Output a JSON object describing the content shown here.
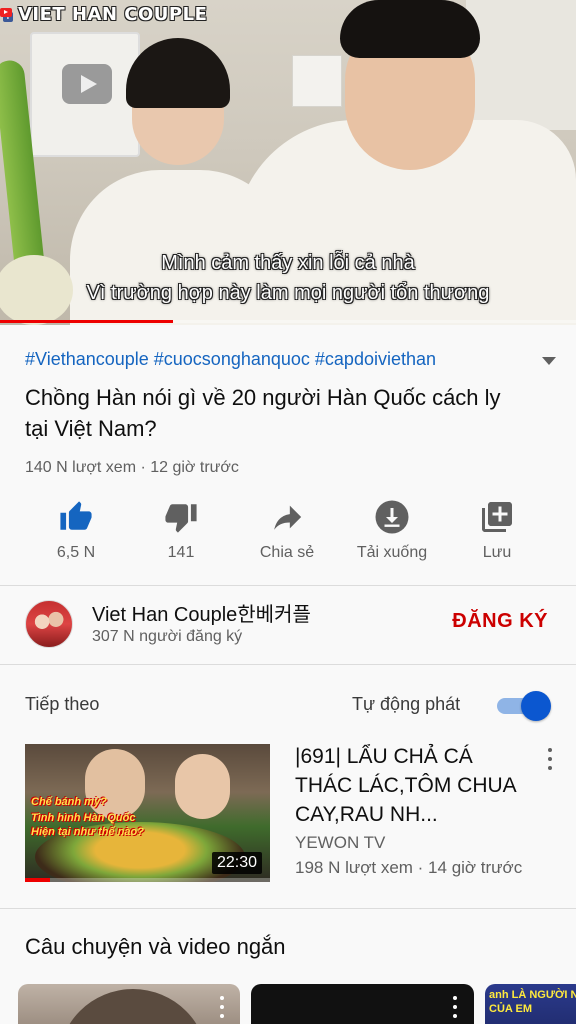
{
  "player": {
    "channel_logo_text": "VIET HAN COUPLE",
    "subtitle_line1": "Mình cảm thấy xin lỗi cả nhà",
    "subtitle_line2": "Vì trường hợp này làm mọi người tổn thương",
    "progress": 0.3
  },
  "video": {
    "hashtags": "#Viethancouple #cuocsonghanquoc #capdoiviethan",
    "title": "Chồng Hàn nói gì về 20 người Hàn Quốc cách ly tại Việt Nam?",
    "meta": "140 N lượt xem · 12 giờ trước"
  },
  "actions": {
    "like": {
      "label": "6,5 N",
      "icon": "thumbs-up-icon"
    },
    "dislike": {
      "label": "141",
      "icon": "thumbs-down-icon"
    },
    "share": {
      "label": "Chia sẻ",
      "icon": "share-icon"
    },
    "download": {
      "label": "Tải xuống",
      "icon": "download-icon"
    },
    "save": {
      "label": "Lưu",
      "icon": "playlist-add-icon"
    }
  },
  "channel": {
    "name": "Viet Han Couple한베커플",
    "subscribers": "307 N người đăng ký",
    "subscribe_label": "ĐĂNG KÝ"
  },
  "up_next": {
    "label": "Tiếp theo",
    "autoplay_label": "Tự động phát",
    "autoplay_on": true,
    "video": {
      "title": "|691| LẨU CHẢ CÁ THÁC LÁC,TÔM CHUA CAY,RAU NH...",
      "channel": "YEWON TV",
      "meta": "198 N lượt xem · 14 giờ trước",
      "duration": "22:30",
      "thumb_line1": "Chế bánh mỳ?",
      "thumb_line2": "Tình hình Hàn Quốc",
      "thumb_line3": "Hiện tại như thế nào?",
      "progress": 0.1
    }
  },
  "shorts_section": {
    "title": "Câu chuyện và video ngắn",
    "third_thumb_text_1": "anh LÀ NGƯỜI NHÀ",
    "third_thumb_text_2": "CỦA EM"
  },
  "colors": {
    "accent_blue": "#1565c0",
    "subscribe_red": "#cc0000",
    "toggle_blue": "#0b57d0",
    "progress_red": "#ee0000"
  }
}
